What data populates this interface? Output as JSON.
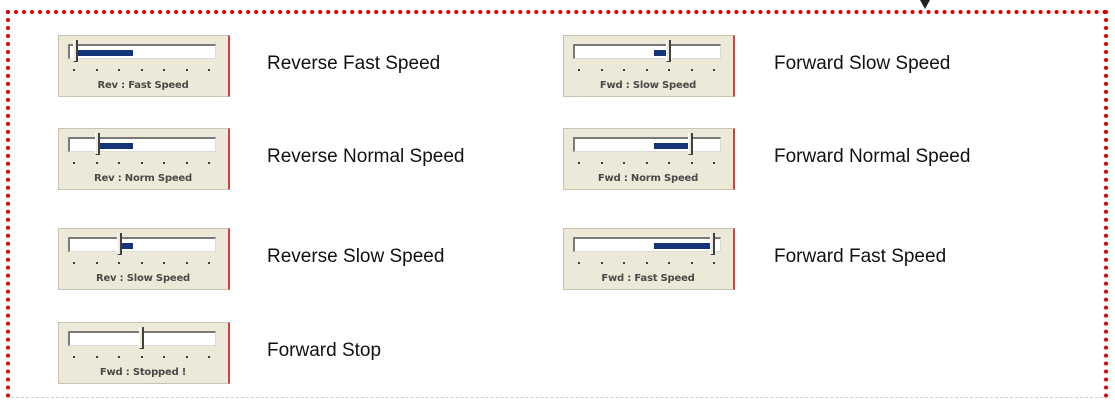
{
  "items": [
    {
      "caption": "Rev : Fast Speed",
      "label": "Reverse Fast Speed",
      "direction": "reverse",
      "level": 1.0
    },
    {
      "caption": "Fwd : Slow Speed",
      "label": "Forward Slow Speed",
      "direction": "forward",
      "level": 0.33
    },
    {
      "caption": "Rev : Norm Speed",
      "label": "Reverse Normal Speed",
      "direction": "reverse",
      "level": 0.66
    },
    {
      "caption": "Fwd : Norm Speed",
      "label": "Forward Normal Speed",
      "direction": "forward",
      "level": 0.66
    },
    {
      "caption": "Rev : Slow Speed",
      "label": "Reverse Slow Speed",
      "direction": "reverse",
      "level": 0.33
    },
    {
      "caption": "Fwd : Fast Speed",
      "label": "Forward Fast Speed",
      "direction": "forward",
      "level": 1.0
    },
    {
      "caption": "Fwd : Stopped !",
      "label": "Forward Stop",
      "direction": "forward",
      "level": 0.0
    }
  ],
  "colors": {
    "border": "#e00000",
    "fill": "#15357a",
    "panel": "#ece9d8"
  }
}
